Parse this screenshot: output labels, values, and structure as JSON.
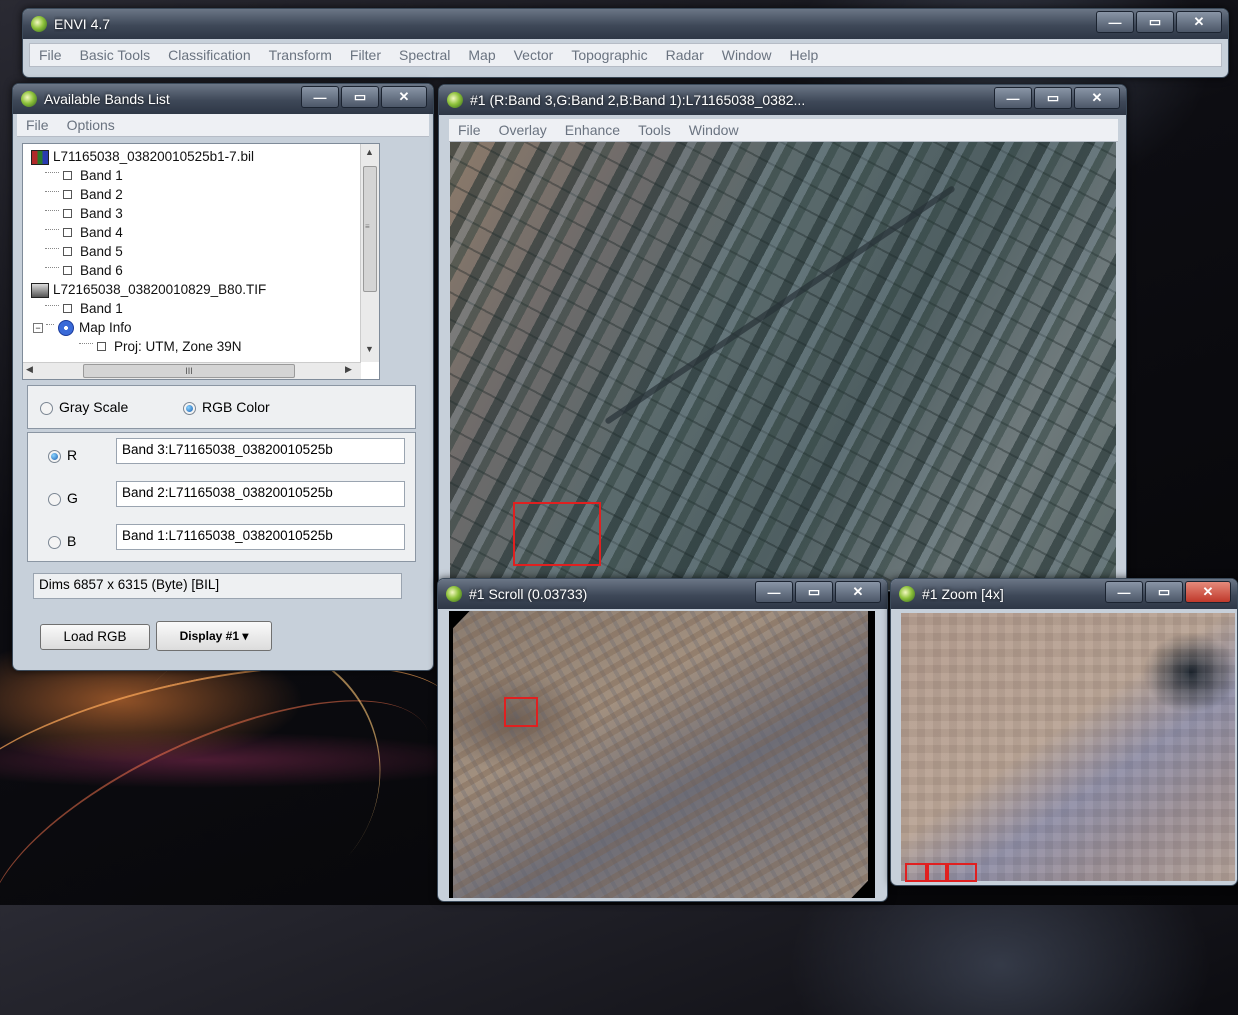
{
  "main_window": {
    "title": "ENVI 4.7",
    "menu": [
      "File",
      "Basic Tools",
      "Classification",
      "Transform",
      "Filter",
      "Spectral",
      "Map",
      "Vector",
      "Topographic",
      "Radar",
      "Window",
      "Help"
    ]
  },
  "bands_list": {
    "title": "Available Bands List",
    "menu": [
      "File",
      "Options"
    ],
    "tree": [
      {
        "kind": "file",
        "label": "L71165038_03820010525b1-7.bil"
      },
      {
        "kind": "band",
        "label": "Band 1"
      },
      {
        "kind": "band",
        "label": "Band 2"
      },
      {
        "kind": "band",
        "label": "Band 3"
      },
      {
        "kind": "band",
        "label": "Band 4"
      },
      {
        "kind": "band",
        "label": "Band 5"
      },
      {
        "kind": "band",
        "label": "Band 6"
      },
      {
        "kind": "file",
        "label": "L72165038_03820010829_B80.TIF"
      },
      {
        "kind": "band",
        "label": "Band 1"
      },
      {
        "kind": "mapinfo",
        "label": "Map Info"
      },
      {
        "kind": "proj",
        "label": "Proj: UTM, Zone 39N"
      }
    ],
    "hscroll_glyph": "III",
    "mode": {
      "gray_label": "Gray Scale",
      "rgb_label": "RGB Color",
      "selected": "rgb"
    },
    "rgb": [
      {
        "letter": "R",
        "value": "Band 3:L71165038_03820010525b",
        "selected": true
      },
      {
        "letter": "G",
        "value": "Band 2:L71165038_03820010525b",
        "selected": false
      },
      {
        "letter": "B",
        "value": "Band 1:L71165038_03820010525b",
        "selected": false
      }
    ],
    "dims": "Dims 6857 x 6315 (Byte) [BIL]",
    "load_button": "Load RGB",
    "display_button": "Display #1"
  },
  "image_window": {
    "title": "#1 (R:Band 3,G:Band 2,B:Band 1):L71165038_0382...",
    "menu": [
      "File",
      "Overlay",
      "Enhance",
      "Tools",
      "Window"
    ]
  },
  "scroll_window": {
    "title": "#1 Scroll (0.03733)"
  },
  "zoom_window": {
    "title": "#1 Zoom [4x]"
  },
  "window_controls": {
    "minimize": "—",
    "maximize": "▭",
    "close": "✕"
  },
  "colors": {
    "selection_box": "#e02020",
    "accent": "#1b5fb0"
  }
}
